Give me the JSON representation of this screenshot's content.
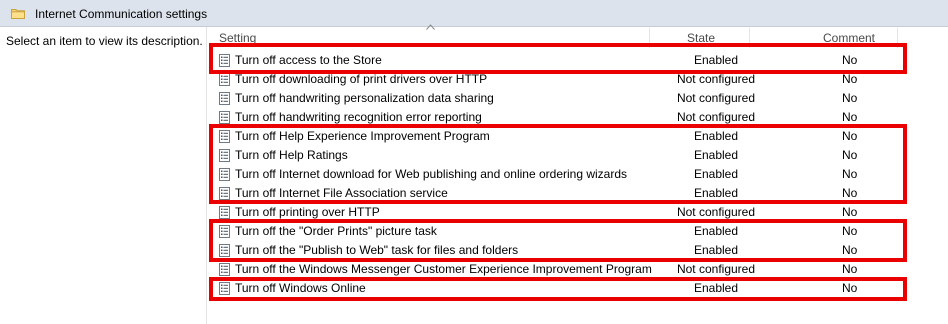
{
  "window": {
    "title": "Internet Communication settings"
  },
  "description_pane": {
    "text": "Select an item to view its description."
  },
  "columns": {
    "setting": "Setting",
    "state": "State",
    "comment": "Comment"
  },
  "policies": [
    {
      "name": "Turn off access to the Store",
      "state": "Enabled",
      "comment": "No",
      "highlighted": true
    },
    {
      "name": "Turn off downloading of print drivers over HTTP",
      "state": "Not configured",
      "comment": "No",
      "highlighted": false
    },
    {
      "name": "Turn off handwriting personalization data sharing",
      "state": "Not configured",
      "comment": "No",
      "highlighted": false
    },
    {
      "name": "Turn off handwriting recognition error reporting",
      "state": "Not configured",
      "comment": "No",
      "highlighted": false
    },
    {
      "name": "Turn off Help Experience Improvement Program",
      "state": "Enabled",
      "comment": "No",
      "highlighted": true
    },
    {
      "name": "Turn off Help Ratings",
      "state": "Enabled",
      "comment": "No",
      "highlighted": true
    },
    {
      "name": "Turn off Internet download for Web publishing and online ordering wizards",
      "state": "Enabled",
      "comment": "No",
      "highlighted": true
    },
    {
      "name": "Turn off Internet File Association service",
      "state": "Enabled",
      "comment": "No",
      "highlighted": true
    },
    {
      "name": "Turn off printing over HTTP",
      "state": "Not configured",
      "comment": "No",
      "highlighted": false
    },
    {
      "name": "Turn off the \"Order Prints\" picture task",
      "state": "Enabled",
      "comment": "No",
      "highlighted": true
    },
    {
      "name": "Turn off the \"Publish to Web\" task for files and folders",
      "state": "Enabled",
      "comment": "No",
      "highlighted": true
    },
    {
      "name": "Turn off the Windows Messenger Customer Experience Improvement Program",
      "state": "Not configured",
      "comment": "No",
      "highlighted": false
    },
    {
      "name": "Turn off Windows Online",
      "state": "Enabled",
      "comment": "No",
      "highlighted": true
    }
  ],
  "colors": {
    "highlight_box": "#ea0000",
    "title_bar": "#dde3ec"
  },
  "icons": {
    "title": "folder-icon",
    "policy_row": "policy-setting-icon",
    "sort": "sort-ascending-icon"
  }
}
